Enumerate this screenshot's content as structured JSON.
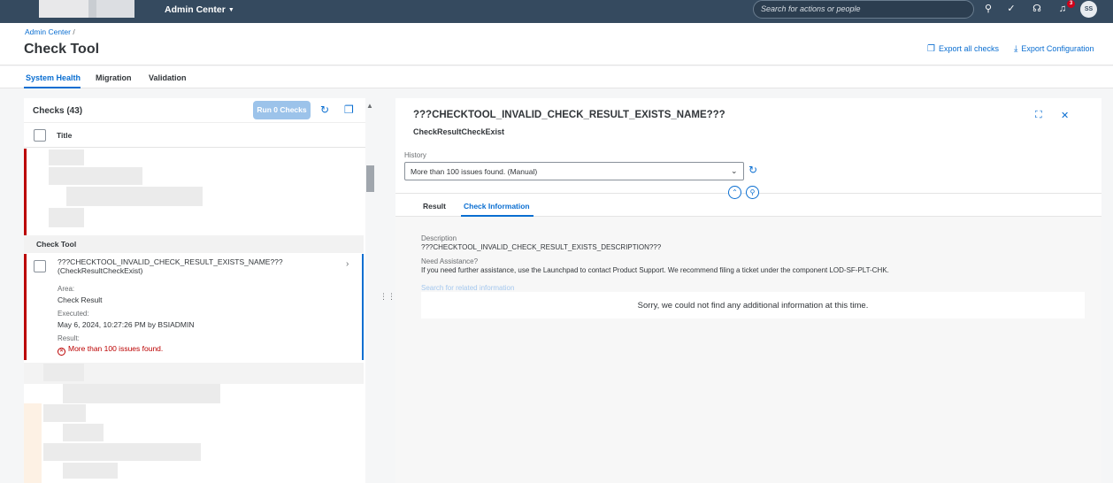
{
  "shell": {
    "title": "Admin Center",
    "search_placeholder": "Search for actions or people",
    "notification_count": "3",
    "avatar_initials": "SS"
  },
  "header": {
    "breadcrumb": "Admin Center",
    "breadcrumb_sep": "/",
    "title": "Check Tool",
    "export_all": "Export all checks",
    "export_config": "Export Configuration"
  },
  "tabs": [
    {
      "label": "System Health",
      "active": true
    },
    {
      "label": "Migration",
      "active": false
    },
    {
      "label": "Validation",
      "active": false
    }
  ],
  "checks": {
    "title": "Checks (43)",
    "run_button": "Run 0 Checks",
    "column_title": "Title",
    "group": "Check Tool",
    "item": {
      "name": "???CHECKTOOL_INVALID_CHECK_RESULT_EXISTS_NAME???",
      "id": "(CheckResultCheckExist)",
      "area_label": "Area:",
      "area_value": "Check Result",
      "executed_label": "Executed:",
      "executed_value": "May 6, 2024, 10:27:26 PM by BSIADMIN",
      "result_label": "Result:",
      "result_value": "More than 100 issues found."
    }
  },
  "detail": {
    "title": "???CHECKTOOL_INVALID_CHECK_RESULT_EXISTS_NAME???",
    "subtitle": "CheckResultCheckExist",
    "history_label": "History",
    "history_value": "More than 100 issues found. (Manual)",
    "tabs": [
      {
        "label": "Result",
        "active": false
      },
      {
        "label": "Check Information",
        "active": true
      }
    ],
    "description_label": "Description",
    "description_value": "???CHECKTOOL_INVALID_CHECK_RESULT_EXISTS_DESCRIPTION???",
    "assist_label": "Need Assistance?",
    "assist_text": "If you need further assistance, use the Launchpad to contact Product Support. We recommend filing a ticket under the component LOD-SF-PLT-CHK.",
    "search_link": "Search for related information",
    "empty_message": "Sorry, we could not find any additional information at this time."
  },
  "colors": {
    "shell": "#354a5f",
    "accent": "#0a6ed1",
    "error": "#bb0000"
  }
}
